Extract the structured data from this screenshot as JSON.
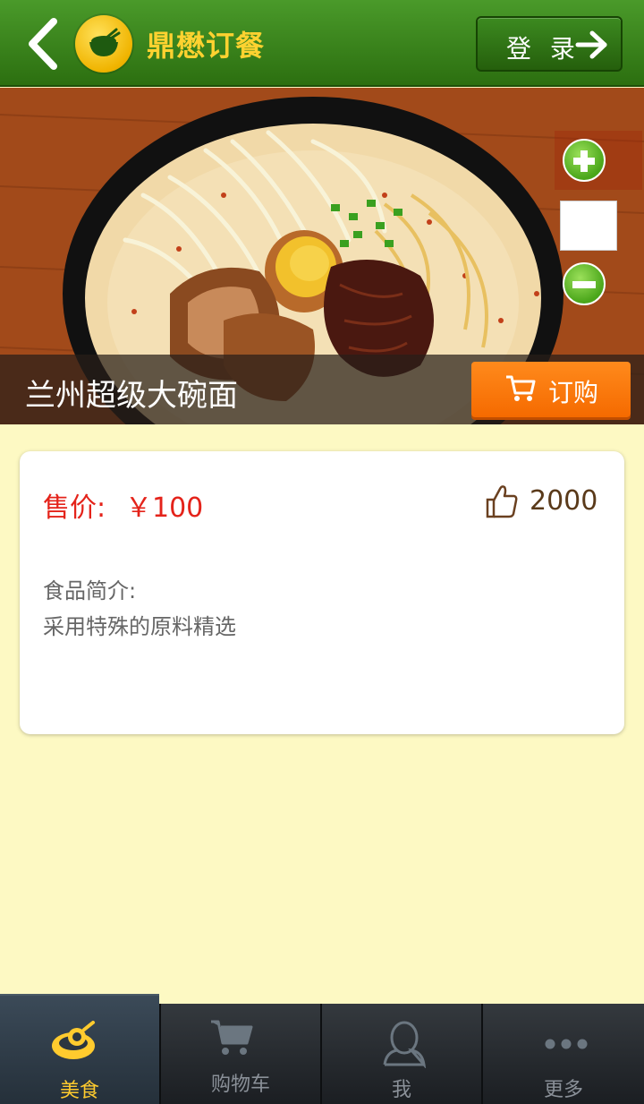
{
  "header": {
    "app_title": "鼎懋订餐",
    "login_label": "登 录",
    "icons": {
      "back": "chevron-left-icon",
      "logo": "rice-bowl-icon",
      "login": "arrow-right-icon"
    }
  },
  "product": {
    "name": "兰州超级大碗面",
    "order_label": "订购",
    "price_label": "售价:",
    "price_value": "￥100",
    "like_count": "2000",
    "description_label": "食品简介:",
    "description": "采用特殊的原料精选"
  },
  "bottom_nav": {
    "items": [
      {
        "label": "美食",
        "icon": "food-icon",
        "active": true
      },
      {
        "label": "购物车",
        "icon": "cart-icon",
        "active": false
      },
      {
        "label": "我",
        "icon": "user-icon",
        "active": false
      },
      {
        "label": "更多",
        "icon": "more-icon",
        "active": false
      }
    ]
  },
  "colors": {
    "header_green": "#2c6f10",
    "title_yellow": "#ffd230",
    "order_orange": "#f56a00",
    "price_red": "#e4231a",
    "page_bg": "#fdf9c3",
    "nav_active": "#ffcb2e"
  }
}
